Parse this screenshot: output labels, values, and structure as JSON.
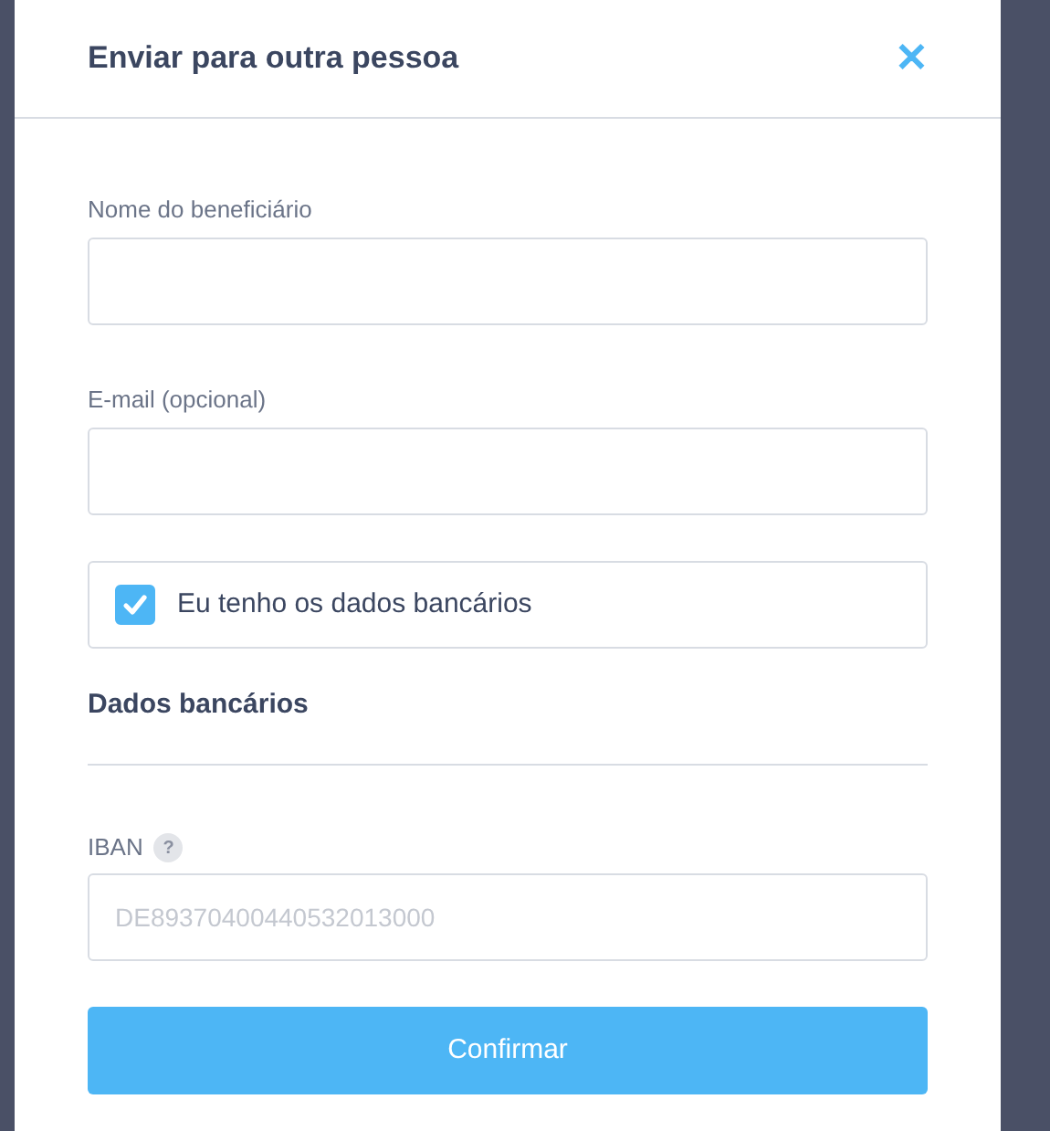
{
  "dialog": {
    "title": "Enviar para outra pessoa",
    "close": "✕"
  },
  "fields": [
    {
      "label": "Nome do beneficiário"
    },
    {
      "label": "E-mail (opcional)"
    }
  ],
  "bank_toggle": {
    "label": "Eu tenho os dados bancários",
    "checked": true
  },
  "section_title": "Dados bancários",
  "iban": {
    "label": "IBAN",
    "help": "?",
    "placeholder": "DE89370400440532013000"
  },
  "confirm_button": "Confirmar"
}
